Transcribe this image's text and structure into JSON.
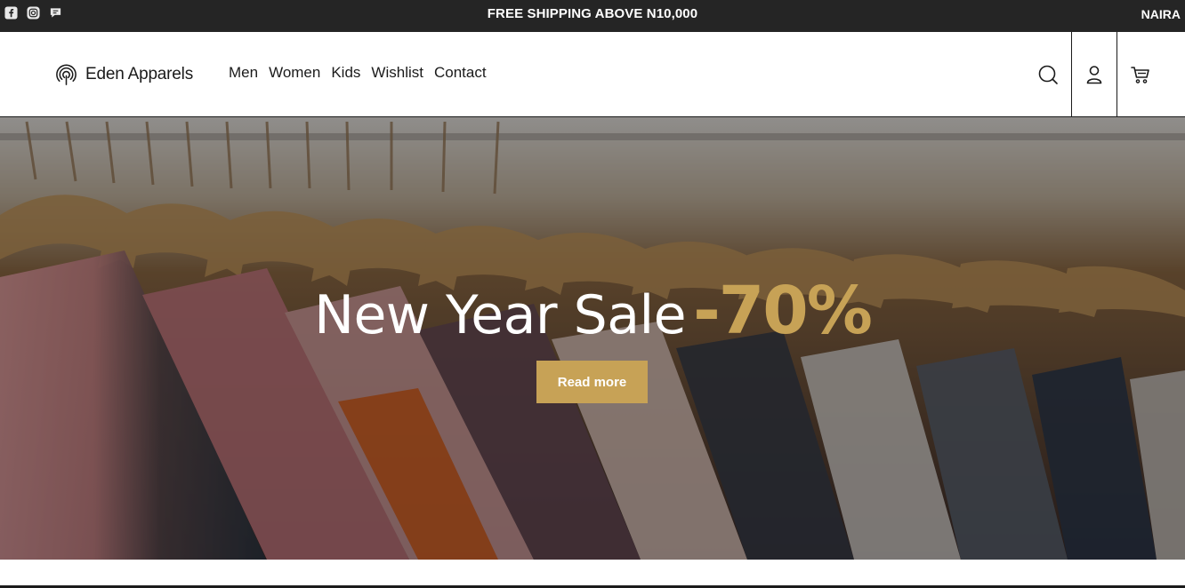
{
  "topbar": {
    "promo": "FREE SHIPPING ABOVE N10,000",
    "currency": "NAIRA",
    "socials": [
      "facebook-icon",
      "instagram-icon",
      "chat-icon"
    ]
  },
  "header": {
    "brand": "Eden Apparels",
    "nav": [
      "Men",
      "Women",
      "Kids",
      "Wishlist",
      "Contact"
    ],
    "icons": [
      "search-icon",
      "user-icon",
      "cart-icon"
    ]
  },
  "hero": {
    "title": "New Year Sale",
    "discount": "-70%",
    "button_label": "Read more"
  },
  "colors": {
    "accent": "#c7a256",
    "topbar": "#252525",
    "text": "#1b1b1b"
  }
}
